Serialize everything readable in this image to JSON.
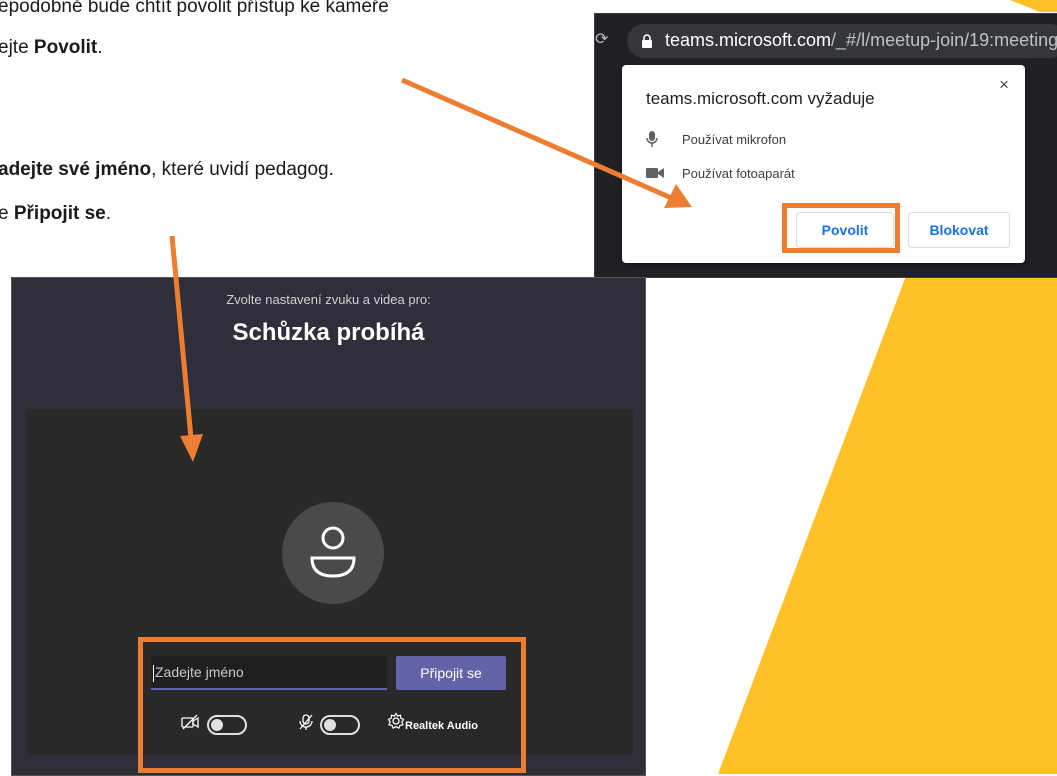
{
  "instructions": {
    "line1": "epodobně bude chtít povolit přístup ke kameře",
    "line2_prefix": "ejte ",
    "line2_bold": "Povolit",
    "line2_suffix": ".",
    "line3_bold": "adejte své jméno",
    "line3_suffix": ", které uvidí pedagog.",
    "line4_prefix": "e ",
    "line4_bold": "Připojit se",
    "line4_suffix": "."
  },
  "browser": {
    "url_domain": "teams.microsoft.com",
    "url_path": "/_#/l/meetup-join/19:meeting",
    "prompt_title": "teams.microsoft.com vyžaduje",
    "close_glyph": "×",
    "permissions": [
      "Používat mikrofon",
      "Používat fotoaparát"
    ],
    "allow_label": "Povolit",
    "block_label": "Blokovat"
  },
  "teams": {
    "subtitle": "Zvolte nastavení zvuku a videa pro:",
    "title": "Schůzka probíhá",
    "name_placeholder": "Zadejte jméno",
    "join_label": "Připojit se",
    "audio_device": "Realtek Audio",
    "camera_on": false,
    "mic_on": false
  },
  "colors": {
    "accent_orange": "#ed7d31",
    "yellow": "#ffc125",
    "teams_purple": "#6264a7",
    "chrome_blue": "#1a73e8"
  },
  "icons": [
    "lock-icon",
    "microphone-icon",
    "camera-icon",
    "close-icon",
    "avatar-icon",
    "camera-off-icon",
    "mic-off-icon",
    "settings-gear-icon"
  ]
}
